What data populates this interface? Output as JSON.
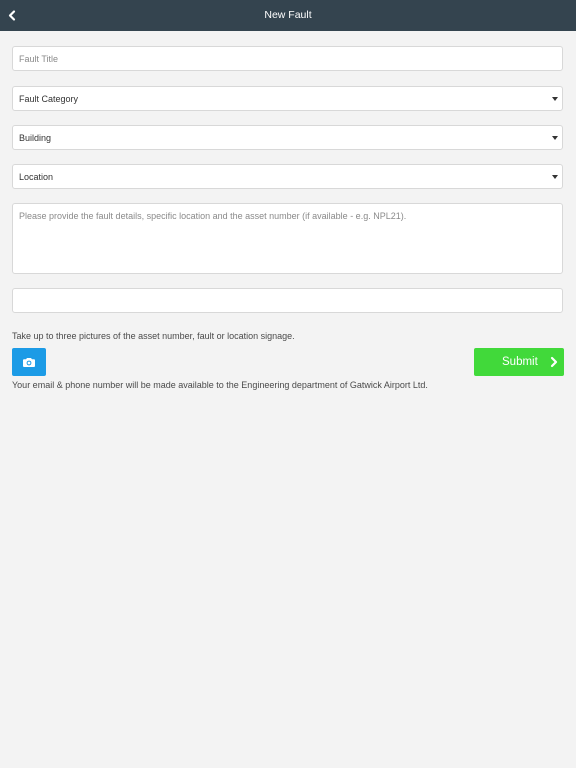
{
  "header": {
    "title": "New Fault",
    "back_icon": "chevron-left-icon"
  },
  "form": {
    "fault_title": {
      "placeholder": "Fault Title",
      "value": ""
    },
    "fault_category": {
      "selected": "Fault Category"
    },
    "building": {
      "selected": "Building"
    },
    "location": {
      "selected": "Location"
    },
    "details": {
      "placeholder": "Please provide the fault details, specific location and the asset number (if available - e.g. NPL21).",
      "value": ""
    },
    "extra_input": {
      "value": ""
    }
  },
  "pictures": {
    "instruction": "Take up to three pictures of the asset number, fault or location signage.",
    "camera_icon": "camera-icon"
  },
  "submit": {
    "label": "Submit",
    "icon": "chevron-right-icon"
  },
  "notice": "Your email & phone number will be made available to the Engineering department of Gatwick Airport Ltd.",
  "colors": {
    "header_bg": "#34444f",
    "camera_button": "#1c9be6",
    "submit_button": "#41d93a",
    "page_bg": "#f3f3f3"
  }
}
